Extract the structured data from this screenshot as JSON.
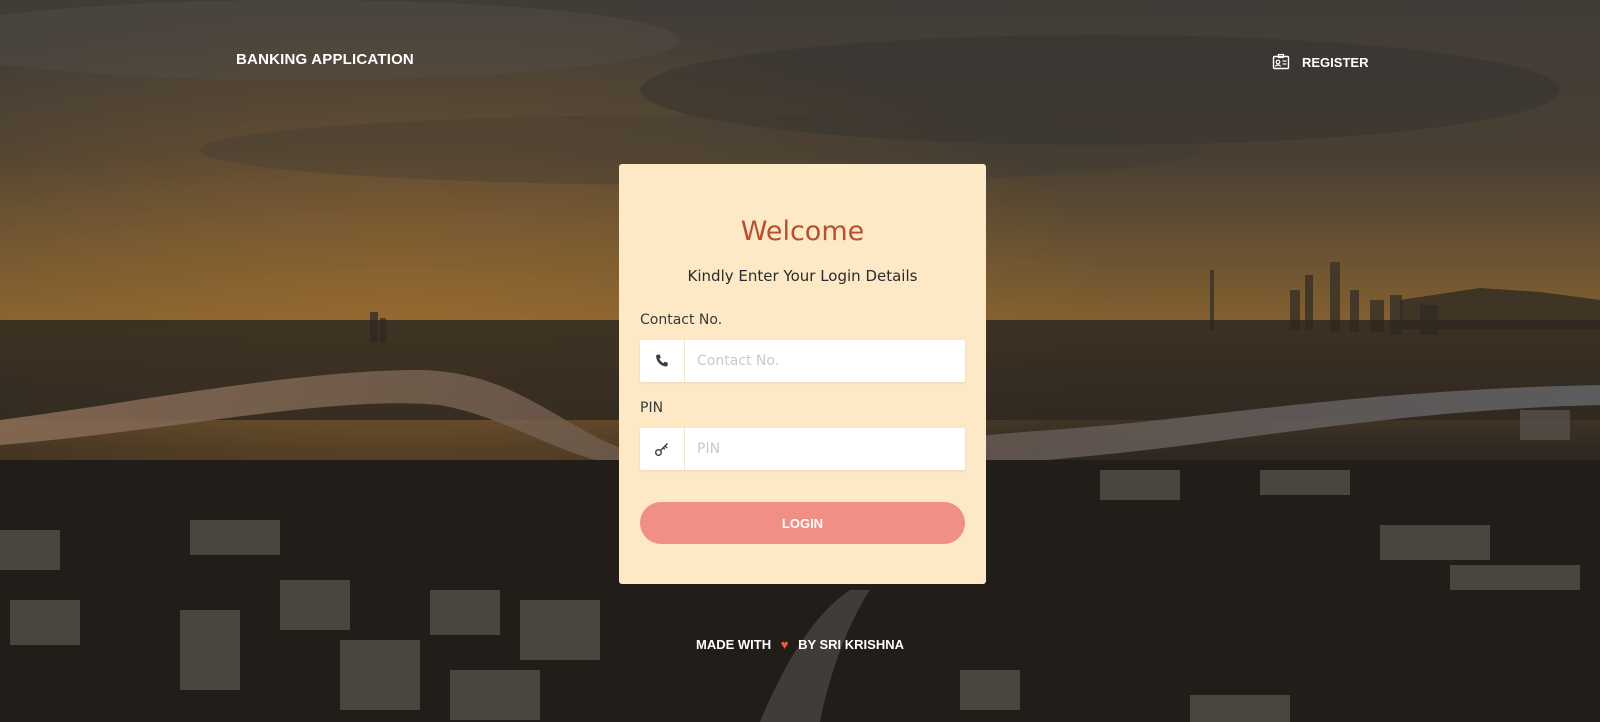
{
  "navbar": {
    "brand": "BANKING APPLICATION",
    "register_label": "REGISTER",
    "register_icon": "id-card-icon"
  },
  "login_card": {
    "title": "Welcome",
    "subtitle": "Kindly Enter Your Login Details",
    "contact": {
      "label": "Contact No.",
      "placeholder": "Contact No.",
      "value": "",
      "icon": "phone-icon"
    },
    "pin": {
      "label": "PIN",
      "placeholder": "PIN",
      "value": "",
      "icon": "key-icon"
    },
    "login_button": "LOGIN"
  },
  "footer": {
    "made_with": "MADE WITH",
    "heart": "♥",
    "by": "BY SRI KRISHNA"
  },
  "colors": {
    "card_background": "#fde9c6",
    "title": "#b5512f",
    "button": "#ef8f86",
    "heart": "#ef5a3a"
  }
}
